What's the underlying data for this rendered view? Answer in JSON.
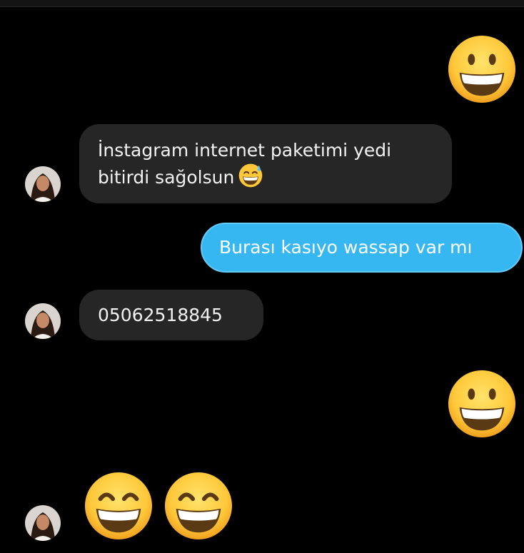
{
  "messages": {
    "m1_emoji": "grinning-face-emoji",
    "m2_line1": "İnstagram internet paketimi yedi",
    "m2_line2": "bitirdi sağolsun",
    "m2_emoji": "grinning-face-with-sweat-emoji",
    "m3_text": "Burası kasıyo wassap var mı",
    "m4_text": "05062518845",
    "m5_emoji": "grinning-face-emoji",
    "m6_emojis": [
      "grinning-face-with-smiling-eyes-emoji",
      "grinning-face-with-smiling-eyes-emoji"
    ]
  },
  "colors": {
    "background": "#000000",
    "incoming_bubble": "#262626",
    "outgoing_bubble": "#36b7f2",
    "text": "#f2f2f2"
  }
}
